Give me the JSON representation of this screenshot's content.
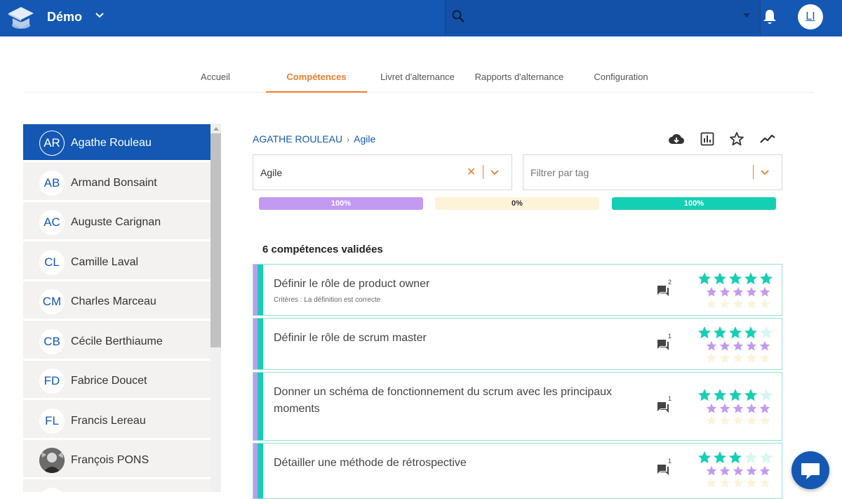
{
  "header": {
    "app_name": "Démo",
    "search_placeholder": "",
    "user_initials": "LI",
    "icons": [
      "graduation-cap-logo",
      "chevron-down-icon",
      "search-icon",
      "caret-down-icon",
      "bell-icon"
    ]
  },
  "tabs": [
    {
      "label": "Accueil",
      "active": false
    },
    {
      "label": "Compétences",
      "active": true
    },
    {
      "label": "Livret d'alternance",
      "active": false
    },
    {
      "label": "Rapports d'alternance",
      "active": false
    },
    {
      "label": "Configuration",
      "active": false
    }
  ],
  "students": [
    {
      "initials": "AR",
      "name": "Agathe Rouleau",
      "active": true
    },
    {
      "initials": "AB",
      "name": "Armand Bonsaint",
      "active": false
    },
    {
      "initials": "AC",
      "name": "Auguste Carignan",
      "active": false
    },
    {
      "initials": "CL",
      "name": "Camille Laval",
      "active": false
    },
    {
      "initials": "CM",
      "name": "Charles Marceau",
      "active": false
    },
    {
      "initials": "CB",
      "name": "Cécile Berthiaume",
      "active": false
    },
    {
      "initials": "FD",
      "name": "Fabrice Doucet",
      "active": false
    },
    {
      "initials": "FL",
      "name": "Francis Lereau",
      "active": false
    },
    {
      "initials": "",
      "name": "François PONS",
      "active": false,
      "photo": true
    }
  ],
  "breadcrumb": {
    "student": "AGATHE ROULEAU",
    "separator": "›",
    "current": "Agile"
  },
  "toolbar_icons": [
    "cloud-download-icon",
    "bar-chart-icon",
    "star-outline-icon",
    "trend-line-icon"
  ],
  "filters": {
    "domain_value": "Agile",
    "tag_placeholder": "Filtrer par tag",
    "clear_symbol": "✕"
  },
  "progress": [
    {
      "label": "100%",
      "fraction": 1.0,
      "color": "#c39af2"
    },
    {
      "label": "0%",
      "fraction": 0.0,
      "color": "#fdf3d9"
    },
    {
      "label": "100%",
      "fraction": 1.0,
      "color": "#14cfb4"
    }
  ],
  "validated_label": "6 compétences validées",
  "competences": [
    {
      "title": "Définir le rôle de product owner",
      "criteria": "Critères : La définition est correcte",
      "comments": "2",
      "ratings": [
        5,
        5,
        0
      ]
    },
    {
      "title": "Définir le rôle de scrum master",
      "criteria": "",
      "comments": "1",
      "ratings": [
        4,
        5,
        0
      ]
    },
    {
      "title": "Donner un schéma de fonctionnement du scrum avec les principaux moments",
      "criteria": "",
      "comments": "1",
      "ratings": [
        4,
        5,
        0
      ]
    },
    {
      "title": "Détailler une méthode de rétrospective",
      "criteria": "",
      "comments": "1",
      "ratings": [
        3,
        5,
        0
      ]
    }
  ],
  "colors": {
    "brand_blue": "#1458b4",
    "accent_orange": "#f07d2a",
    "teal": "#14cfb4",
    "purple": "#c39af2",
    "cream": "#fdf3d9"
  }
}
